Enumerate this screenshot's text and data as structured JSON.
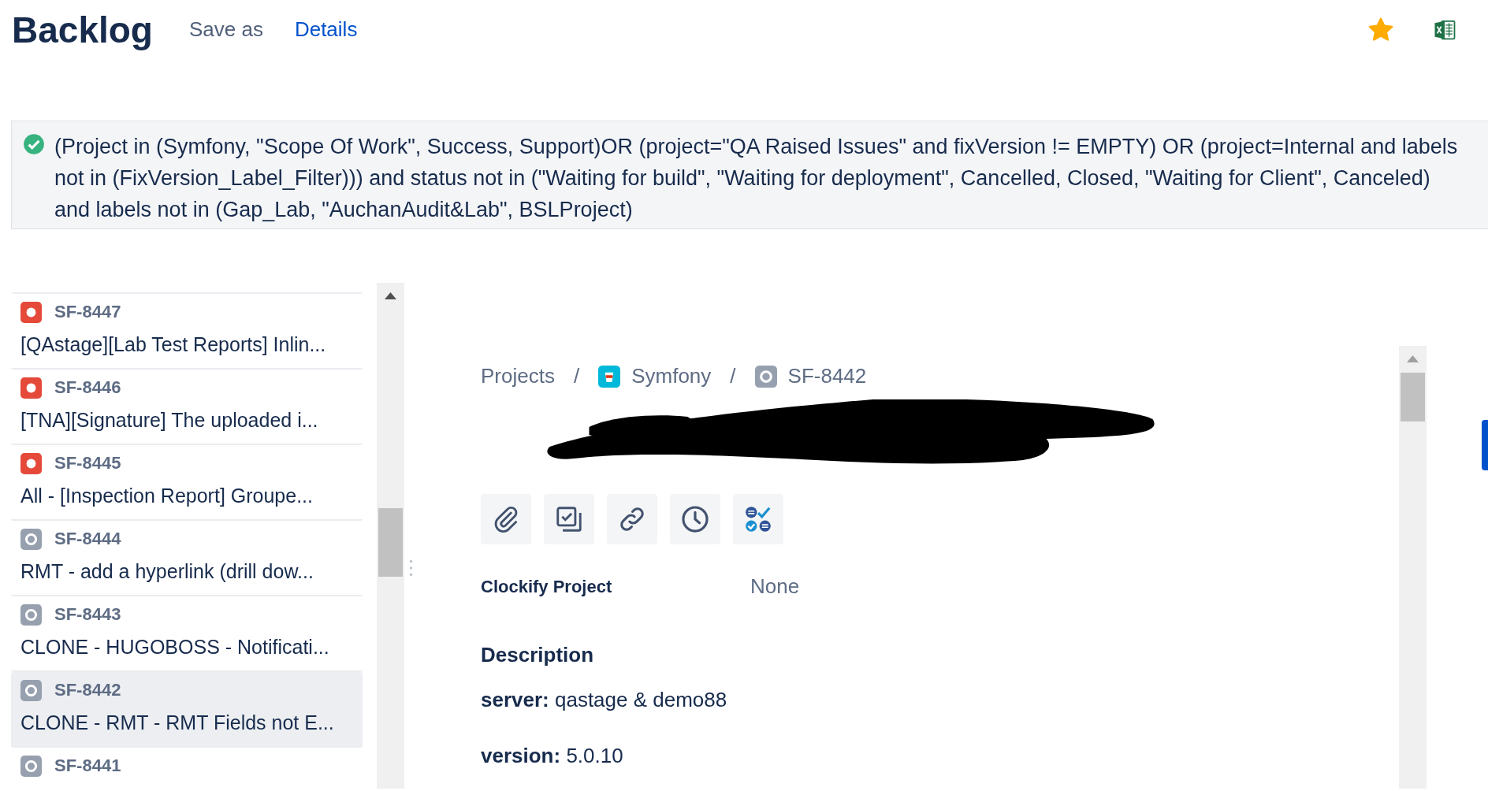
{
  "header": {
    "title": "Backlog",
    "links": [
      {
        "label": "Save as",
        "kind": "plain"
      },
      {
        "label": "Details",
        "kind": "link"
      }
    ],
    "starred": true
  },
  "query": {
    "valid": true,
    "lines": [
      "(Project in (Symfony, \"Scope Of Work\", Success, Support)OR (project=\"QA Raised Issues\" and fixVersion != EMPTY) OR (project=Internal and labels",
      "not in (FixVersion_Label_Filter))) and status not in (\"Waiting for build\", \"Waiting for deployment\", Cancelled, Closed, \"Waiting for Client\", Canceled)",
      "and labels not in (Gap_Lab, \"AuchanAudit&Lab\",  BSLProject)"
    ]
  },
  "issues": [
    {
      "key": "SF-8447",
      "summary": "[QAstage][Lab Test Reports] Inlin...",
      "kind": "bug",
      "selected": false
    },
    {
      "key": "SF-8446",
      "summary": "[TNA][Signature] The uploaded i...",
      "kind": "bug",
      "selected": false
    },
    {
      "key": "SF-8445",
      "summary": "All - [Inspection Report] Groupe...",
      "kind": "bug",
      "selected": false
    },
    {
      "key": "SF-8444",
      "summary": "RMT - add a hyperlink (drill dow...",
      "kind": "task",
      "selected": false
    },
    {
      "key": "SF-8443",
      "summary": "CLONE - HUGOBOSS - Notificati...",
      "kind": "task",
      "selected": false
    },
    {
      "key": "SF-8442",
      "summary": "CLONE - RMT - RMT Fields not E...",
      "kind": "task",
      "selected": true
    },
    {
      "key": "SF-8441",
      "kind": "task",
      "selected": false
    }
  ],
  "detail": {
    "breadcrumbs": [
      {
        "label": "Projects",
        "kind": "text"
      },
      {
        "separator": "/",
        "label": "Symfony",
        "kind": "project"
      },
      {
        "separator": "/",
        "label": "SF-8442",
        "kind": "issue"
      }
    ],
    "fields": [
      {
        "label": "Clockify Project",
        "value": "None"
      }
    ],
    "description": {
      "heading": "Description",
      "lines": [
        "**server:** qastage & demo88",
        "**version:** 5.0.10"
      ]
    }
  }
}
